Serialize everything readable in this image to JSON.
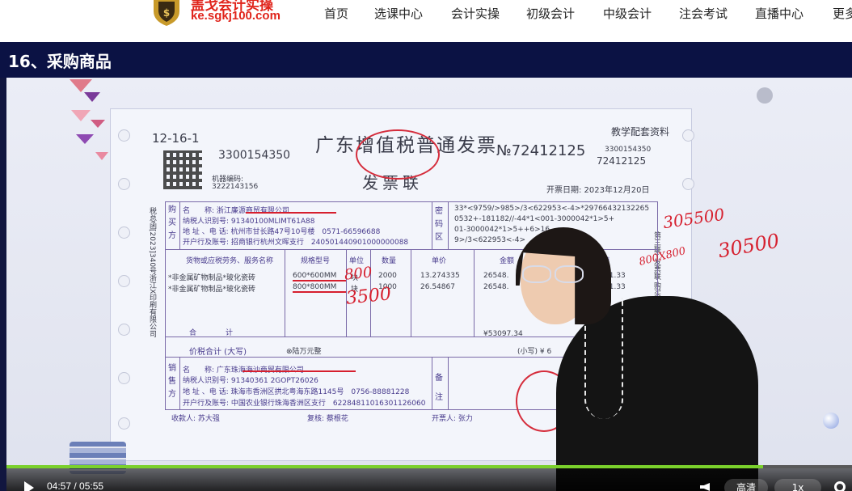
{
  "header": {
    "logo_line1": "盖戈会计实操",
    "logo_line2": "ke.sgkj100.com",
    "nav": [
      "首页",
      "选课中心",
      "会计实操",
      "初级会计",
      "中级会计",
      "注会考试",
      "直播中心",
      "更多"
    ]
  },
  "lesson_title": "16、采购商品",
  "invoice": {
    "number_code": "12-16-1",
    "title": "广东增值税普通发票",
    "subtitle": "发票联",
    "serial_left": "3300154350",
    "no_label": "№72412125",
    "serial_right1": "3300154350",
    "serial_right2": "72412125",
    "teaching_note": "教学配套资料",
    "machine_label": "机器编码:",
    "machine_code": "3222143156",
    "date": "开票日期: 2023年12月20日",
    "buyer_label": "购买方",
    "buyer_name": "名　　称: 浙江廉源商贸有限公司",
    "buyer_tax": "纳税人识别号: 91340100MLIMT61A88",
    "buyer_addr": "地 址 、电 话: 杭州市甘长路47号10号楼　0571-66596688",
    "buyer_bank": "开户行及账号: 招商银行杭州文晖支行　240501440901000000088",
    "cipher_label": "密码区",
    "cipher_lines": [
      "33*<9759/>985>/3<622953<-4>*29766432132265",
      "0532+-181182//-44*1<001-3000042*1>5+",
      "01-3000042*1>5++6>16",
      "9>/3<622953<-4>"
    ],
    "col_goods": "货物或应税劳务、服务名称",
    "col_spec": "规格型号",
    "col_unit": "单位",
    "col_qty": "数量",
    "col_price": "单价",
    "col_amount": "金额",
    "col_tax": "税额",
    "row1": {
      "name": "*非金属矿物制品*玻化瓷砖",
      "spec": "600*600MM",
      "unit": "块",
      "qty": "2000",
      "price": "13.274335",
      "amount": "26548.",
      "tax": "51.33"
    },
    "row2": {
      "name": "*非金属矿物制品*玻化瓷砖",
      "spec": "800*800MM",
      "unit": "块",
      "qty": "1000",
      "price": "26.54867",
      "amount": "26548.",
      "tax": "51.33"
    },
    "total_label": "合　　　　计",
    "total_amount": "¥53097.34",
    "total_words_label": "价税合计 (大写)",
    "total_words": "⊗陆万元整",
    "total_small": "(小写) ¥ 6",
    "seller_label": "销售方",
    "seller_name": "名　　称: 广东珠海海沙商贸有限公司",
    "seller_tax": "纳税人识别号: 91340361 2GOPT26026",
    "seller_addr": "地 址 、电 话: 珠海市香洲区拱北粤海东路1145号　0756-88881228",
    "seller_bank": "开户行及账号: 中国农业银行珠海香洲区支行　62284811016301126060",
    "remark_label": "备注",
    "payee": "收款人: 苏大强",
    "reviewer": "复核: 蔡根花",
    "drawer": "开票人: 张力",
    "side_text": "税总函[2023]340号浙江X印刷有限公司",
    "copy_label": "第三联: 发票联 购买方记账凭证"
  },
  "annotations": {
    "a1": "305500",
    "a2": "30500",
    "a3": "800X800",
    "a4": "800",
    "a5": "3500"
  },
  "player": {
    "time": "04:57 / 05:55",
    "progress_fraction": 0.895,
    "quality": "高清",
    "speed": "1x"
  },
  "colors": {
    "titlebar": "#0b1244",
    "progress": "#7bd12c",
    "brand_red": "#e0241b"
  }
}
